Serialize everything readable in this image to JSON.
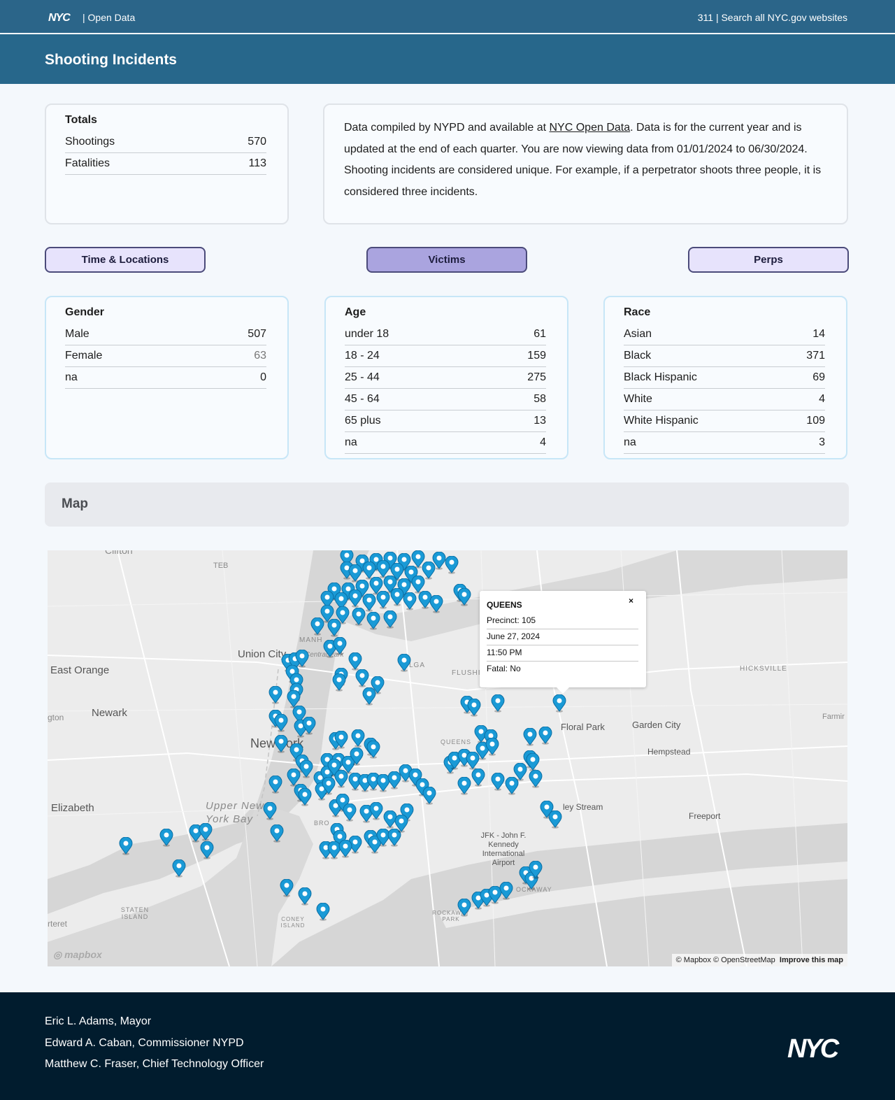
{
  "topbar": {
    "logo_text": "NYC",
    "open_data": "| Open Data",
    "right_links": "311 | Search all NYC.gov websites"
  },
  "page": {
    "title": "Shooting Incidents"
  },
  "totals": {
    "title": "Totals",
    "rows": [
      {
        "label": "Shootings",
        "value": "570"
      },
      {
        "label": "Fatalities",
        "value": "113"
      }
    ]
  },
  "description": {
    "part1": "Data compiled by NYPD and available at ",
    "link": "NYC Open Data",
    "part2": ". Data is for the current year and is updated at the end of each quarter. You are now viewing data from 01/01/2024 to 06/30/2024. Shooting incidents are considered unique. For example, if a perpetrator shoots three people, it is considered three incidents."
  },
  "tabs": [
    {
      "label": "Time & Locations",
      "active": false
    },
    {
      "label": "Victims",
      "active": true
    },
    {
      "label": "Perps",
      "active": false
    }
  ],
  "gender": {
    "title": "Gender",
    "rows": [
      {
        "label": "Male",
        "value": "507"
      },
      {
        "label": "Female",
        "value": "63"
      },
      {
        "label": "na",
        "value": "0"
      }
    ]
  },
  "age": {
    "title": "Age",
    "rows": [
      {
        "label": "under 18",
        "value": "61"
      },
      {
        "label": "18 - 24",
        "value": "159"
      },
      {
        "label": "25 - 44",
        "value": "275"
      },
      {
        "label": "45 - 64",
        "value": "58"
      },
      {
        "label": "65 plus",
        "value": "13"
      },
      {
        "label": "na",
        "value": "4"
      }
    ]
  },
  "race": {
    "title": "Race",
    "rows": [
      {
        "label": "Asian",
        "value": "14"
      },
      {
        "label": "Black",
        "value": "371"
      },
      {
        "label": "Black Hispanic",
        "value": "69"
      },
      {
        "label": "White",
        "value": "4"
      },
      {
        "label": "White Hispanic",
        "value": "109"
      },
      {
        "label": "na",
        "value": "3"
      }
    ]
  },
  "map": {
    "header": "Map",
    "labels": {
      "clifton": "Clifton",
      "teb": "TEB",
      "east_orange": "East Orange",
      "union_city": "Union City",
      "manh": "MANH",
      "central_park": "Central Park",
      "lga": "LGA",
      "flushing": "FLUSHIN",
      "hicksville": "HICKSVILLE",
      "irvington": "gton",
      "newark": "Newark",
      "farming": "Farmir",
      "floral_park": "Floral Park",
      "garden_city": "Garden City",
      "new_york": "New York",
      "queens": "QUEENS",
      "hempstead": "Hempstead",
      "elizabeth": "Elizabeth",
      "upper_bay": "Upper New York Bay",
      "valley_stream": "ley Stream",
      "freeport": "Freeport",
      "brooklyn": "BRO",
      "jfk": "JFK - John F. Kennedy International Airport",
      "rockaway": "OCKAWAY",
      "staten_island": "STATEN ISLAND",
      "coney_island": "CONEY ISLAND",
      "rockaway_park": "ROCKAWAY PARK",
      "carteret": "rteret"
    },
    "popup": {
      "close": "×",
      "title": "QUEENS",
      "precinct": "Precinct: 105",
      "date": "June 27, 2024",
      "time": "11:50 PM",
      "fatal": "Fatal: No"
    },
    "mapbox_logo": "mapbox",
    "attribution": "© Mapbox © OpenStreetMap",
    "improve": "Improve this map",
    "pin_color": "#1a9ad6"
  },
  "footer": {
    "lines": [
      "Eric L. Adams, Mayor",
      "Edward A. Caban, Commissioner NYPD",
      "Matthew C. Fraser, Chief Technology Officer"
    ],
    "logo": "NYC"
  }
}
